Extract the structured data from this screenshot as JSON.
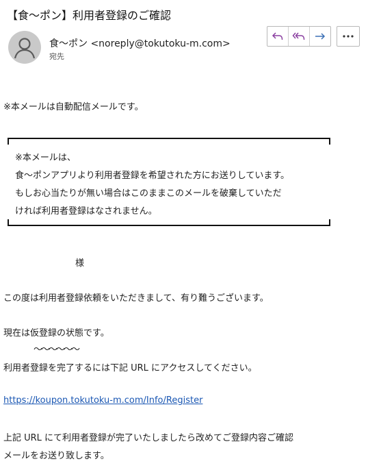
{
  "email": {
    "subject": "【食〜ポン】利用者登録のご確認",
    "sender": "食〜ポン <noreply@tokutoku-m.com>",
    "recipient_label": "宛先"
  },
  "actions": {
    "reply": "reply-icon",
    "reply_all": "reply-all-icon",
    "forward": "forward-icon",
    "more": "more-icon"
  },
  "body": {
    "auto_notice": "※本メールは自動配信メールです。",
    "box_lines": [
      "※本メールは、",
      "食〜ポンアプリより利用者登録を希望された方にお送りしています。",
      "もしお心当たりが無い場合はこのままこのメールを破棄していただ",
      "ければ利用者登録はなされません。"
    ],
    "salutation": "様",
    "thanks": "この度は利用者登録依頼をいただきまして、有り難うございます。",
    "status": "現在は仮登録の状態です。",
    "tilde": "〜〜〜〜〜〜",
    "instruction": "利用者登録を完了するには下記 URL にアクセスしてください。",
    "url": "https://koupon.tokutoku-m.com/Info/Register",
    "closing_1": "上記 URL にて利用者登録が完了いたしましたら改めてご登録内容ご確認",
    "closing_2": "メールをお送り致します。"
  },
  "colors": {
    "action_icon": "#8a3fa0",
    "forward_icon": "#3a6fb5",
    "link": "#1a57b3"
  }
}
